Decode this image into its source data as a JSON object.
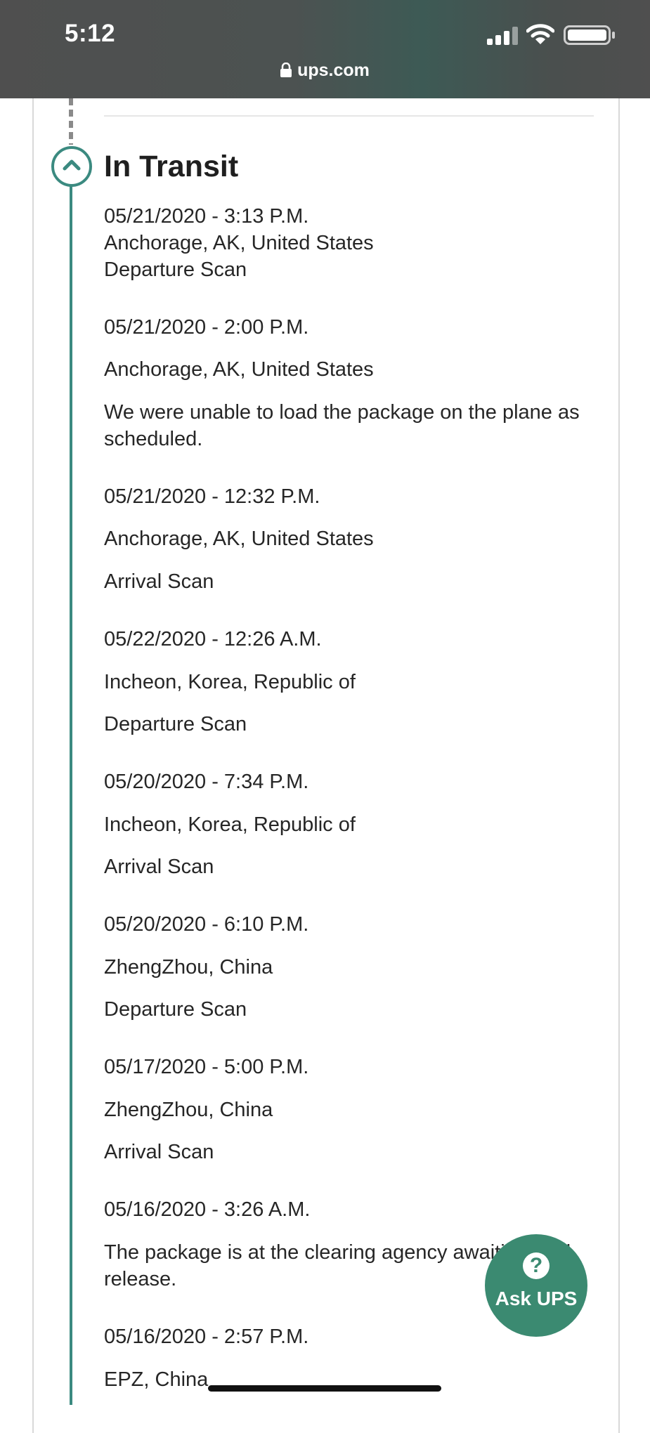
{
  "status_bar": {
    "time": "5:12"
  },
  "browser": {
    "url": "ups.com"
  },
  "section": {
    "title": "In Transit"
  },
  "events": [
    {
      "datetime": "05/21/2020 - 3:13 P.M.",
      "location": "Anchorage, AK, United States",
      "activity": "Departure Scan"
    },
    {
      "datetime": "05/21/2020 - 2:00 P.M.",
      "location": "Anchorage, AK, United States",
      "activity": "We were unable to load the package on the plane as scheduled."
    },
    {
      "datetime": "05/21/2020 - 12:32 P.M.",
      "location": "Anchorage, AK, United States",
      "activity": "Arrival Scan"
    },
    {
      "datetime": "05/22/2020 - 12:26 A.M.",
      "location": "Incheon, Korea, Republic of",
      "activity": "Departure Scan"
    },
    {
      "datetime": "05/20/2020 - 7:34 P.M.",
      "location": "Incheon, Korea, Republic of",
      "activity": "Arrival Scan"
    },
    {
      "datetime": "05/20/2020 - 6:10 P.M.",
      "location": "ZhengZhou, China",
      "activity": "Departure Scan"
    },
    {
      "datetime": "05/17/2020 - 5:00 P.M.",
      "location": "ZhengZhou, China",
      "activity": "Arrival Scan"
    },
    {
      "datetime": "05/16/2020 - 3:26 A.M.",
      "activity": "The package is at the clearing agency awaiting final release."
    },
    {
      "datetime": "05/16/2020 - 2:57 P.M.",
      "location": "EPZ, China"
    }
  ],
  "ask_ups": {
    "label": "Ask UPS",
    "icon": "question-icon"
  },
  "colors": {
    "accent": "#3b8a80",
    "ask_button": "#3b8a71",
    "topbar": "#4f4f4f"
  }
}
